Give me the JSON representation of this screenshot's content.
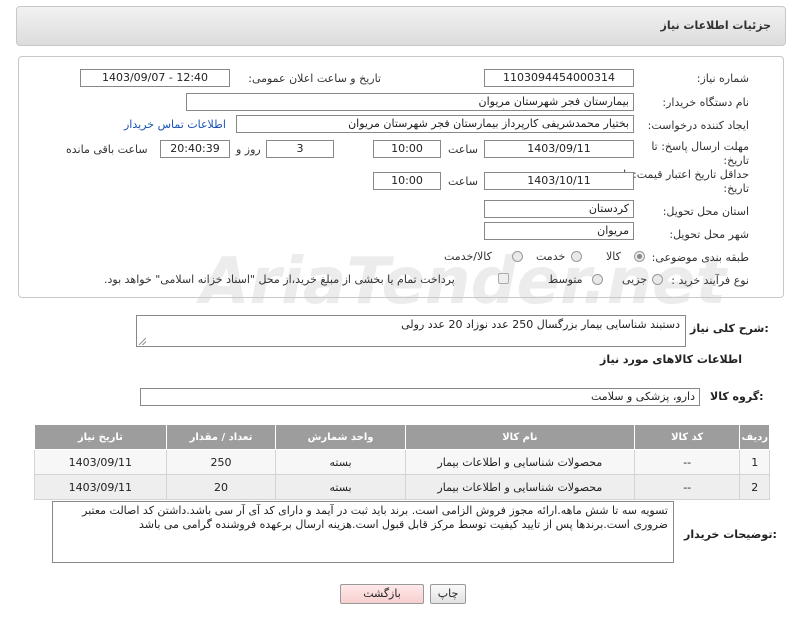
{
  "page_title": "جزئیات اطلاعات نیاز",
  "fields": {
    "need_number_label": "شماره نیاز:",
    "need_number": "1103094454000314",
    "announce_label": "تاریخ و ساعت اعلان عمومی:",
    "announce_value": "1403/09/07 - 12:40",
    "buyer_org_label": "نام دستگاه خریدار:",
    "buyer_org": "بیمارستان فجر شهرستان مریوان",
    "requester_label": "ایجاد کننده درخواست:",
    "requester": "بختیار محمدشریفی کارپرداز بیمارستان فجر شهرستان مریوان",
    "contact_link": "اطلاعات تماس خریدار",
    "deadline_label": "مهلت ارسال پاسخ: تا تاریخ:",
    "deadline_date": "1403/09/11",
    "time_label": "ساعت",
    "deadline_time": "10:00",
    "days_value": "3",
    "days_label": "روز و",
    "remaining_time": "20:40:39",
    "remaining_label": "ساعت باقی مانده",
    "validity_label": "حداقل تاریخ اعتبار قیمت: تا تاریخ:",
    "validity_date": "1403/10/11",
    "validity_time_label": "ساعت",
    "validity_time": "10:00",
    "province_label": "استان محل تحویل:",
    "province": "کردستان",
    "city_label": "شهر محل تحویل:",
    "city": "مریوان",
    "category_label": "طبقه بندی موضوعی:",
    "category_options": [
      "کالا",
      "خدمت",
      "کالا/خدمت"
    ],
    "process_label": "نوع فرآیند خرید :",
    "process_options": [
      "جزیی",
      "متوسط"
    ],
    "payment_note": "پرداخت تمام یا بخشی از مبلغ خرید،از محل \"اسناد خزانه اسلامی\" خواهد بود."
  },
  "summary_label": "شرح کلی نیاز:",
  "summary_value": "دستبند شناسایی بیمار بزرگسال 250 عدد نوزاد 20 عدد رولی",
  "goods_info_title": "اطلاعات کالاهای مورد نیاز",
  "goods_group_label": "گروه کالا:",
  "goods_group": "دارو، پزشکی و سلامت",
  "table": {
    "headers": [
      "ردیف",
      "کد کالا",
      "نام کالا",
      "واحد شمارش",
      "تعداد / مقدار",
      "تاریخ نیاز"
    ],
    "rows": [
      [
        "1",
        "--",
        "محصولات شناسایی و اطلاعات بیمار",
        "بسته",
        "250",
        "1403/09/11"
      ],
      [
        "2",
        "--",
        "محصولات شناسایی و اطلاعات بیمار",
        "بسته",
        "20",
        "1403/09/11"
      ]
    ]
  },
  "buyer_notes_label": "توضیحات خریدار:",
  "buyer_notes": "تسویه سه تا شش ماهه.ارائه مجوز فروش الزامی است. برند باید ثبت در آیمد و دارای کد آی آر سی باشد.داشتن کد اصالت معتبر ضروری است.برندها پس از تایید کیفیت توسط مرکز قابل قبول است.هزینه ارسال برعهده فروشنده گرامی می باشد",
  "buttons": {
    "print": "چاپ",
    "back": "بازگشت"
  },
  "watermark": "AriaTender.net"
}
